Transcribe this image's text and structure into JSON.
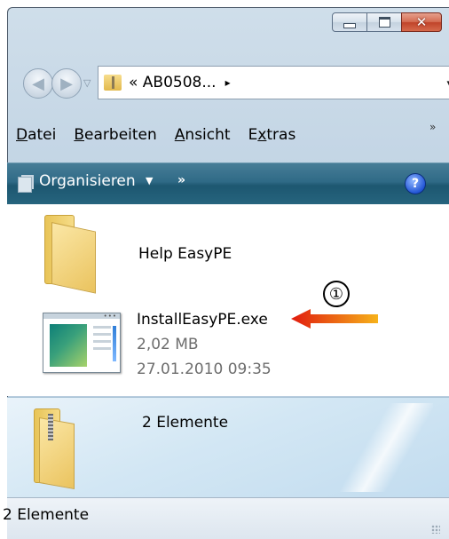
{
  "address": {
    "path": "« AB0508...",
    "arrow": "▸",
    "dropdown": "▾"
  },
  "menu": [
    {
      "accel": "D",
      "rest": "atei"
    },
    {
      "accel": "B",
      "rest": "earbeiten"
    },
    {
      "accel": "A",
      "rest": "nsicht"
    },
    {
      "pre": "E",
      "accel": "x",
      "rest": "tras"
    }
  ],
  "menu_more": "»",
  "toolbar": {
    "organize_label": "Organisieren",
    "organize_caret": "▼",
    "more": "»",
    "help": "?"
  },
  "files": [
    {
      "name": "Help EasyPE",
      "icon": "folder-icon"
    },
    {
      "name": "InstallEasyPE.exe",
      "size": "2,02 MB",
      "date": "27.01.2010 09:35",
      "icon": "exe-icon"
    }
  ],
  "annotation": {
    "number": "①",
    "arrow_color": "#f08010"
  },
  "details": {
    "text": "2 Elemente",
    "icon": "zip-folder-icon"
  },
  "status": {
    "text": "2 Elemente"
  },
  "colors": {
    "toolbar": "#2f6a86",
    "frame": "#bfd2e3",
    "close_button": "#c0432a"
  }
}
